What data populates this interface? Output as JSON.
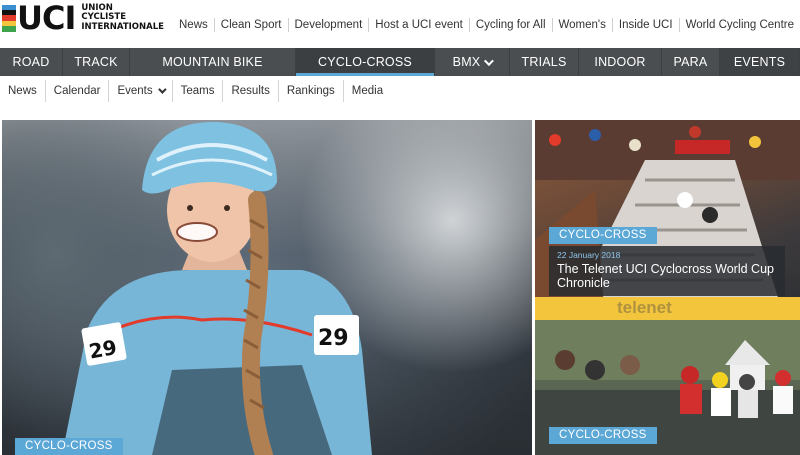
{
  "logo": {
    "letters": "UCI",
    "line1": "UNION",
    "line2": "CYCLISTE",
    "line3": "INTERNATIONALE",
    "stripe_colors": [
      "#3b8fd1",
      "#111111",
      "#e23a2b",
      "#f2c53d",
      "#3ea34b"
    ]
  },
  "top_links": [
    "News",
    "Clean Sport",
    "Development",
    "Host a UCI event",
    "Cycling for All",
    "Women's",
    "Inside UCI",
    "World Cycling Centre"
  ],
  "main_nav": [
    {
      "label": "ROAD"
    },
    {
      "label": "TRACK"
    },
    {
      "label": "MOUNTAIN BIKE"
    },
    {
      "label": "CYCLO-CROSS"
    },
    {
      "label": "BMX"
    },
    {
      "label": "TRIALS"
    },
    {
      "label": "INDOOR"
    },
    {
      "label": "PARA"
    },
    {
      "label": "EVENTS"
    }
  ],
  "sub_nav": [
    "News",
    "Calendar",
    "Events",
    "Teams",
    "Results",
    "Rankings",
    "Media"
  ],
  "hero": {
    "badge": "CYCLO-CROSS"
  },
  "card1": {
    "badge": "CYCLO-CROSS",
    "date": "22 January 2018",
    "title": "The Telenet UCI Cyclocross World Cup Chronicle",
    "sponsor": "telenet"
  },
  "card2": {
    "badge": "CYCLO-CROSS"
  },
  "colors": {
    "accent": "#5ba7d6",
    "nav_bg": "#4a4e51",
    "sponsor_yellow": "#f2c53d"
  }
}
